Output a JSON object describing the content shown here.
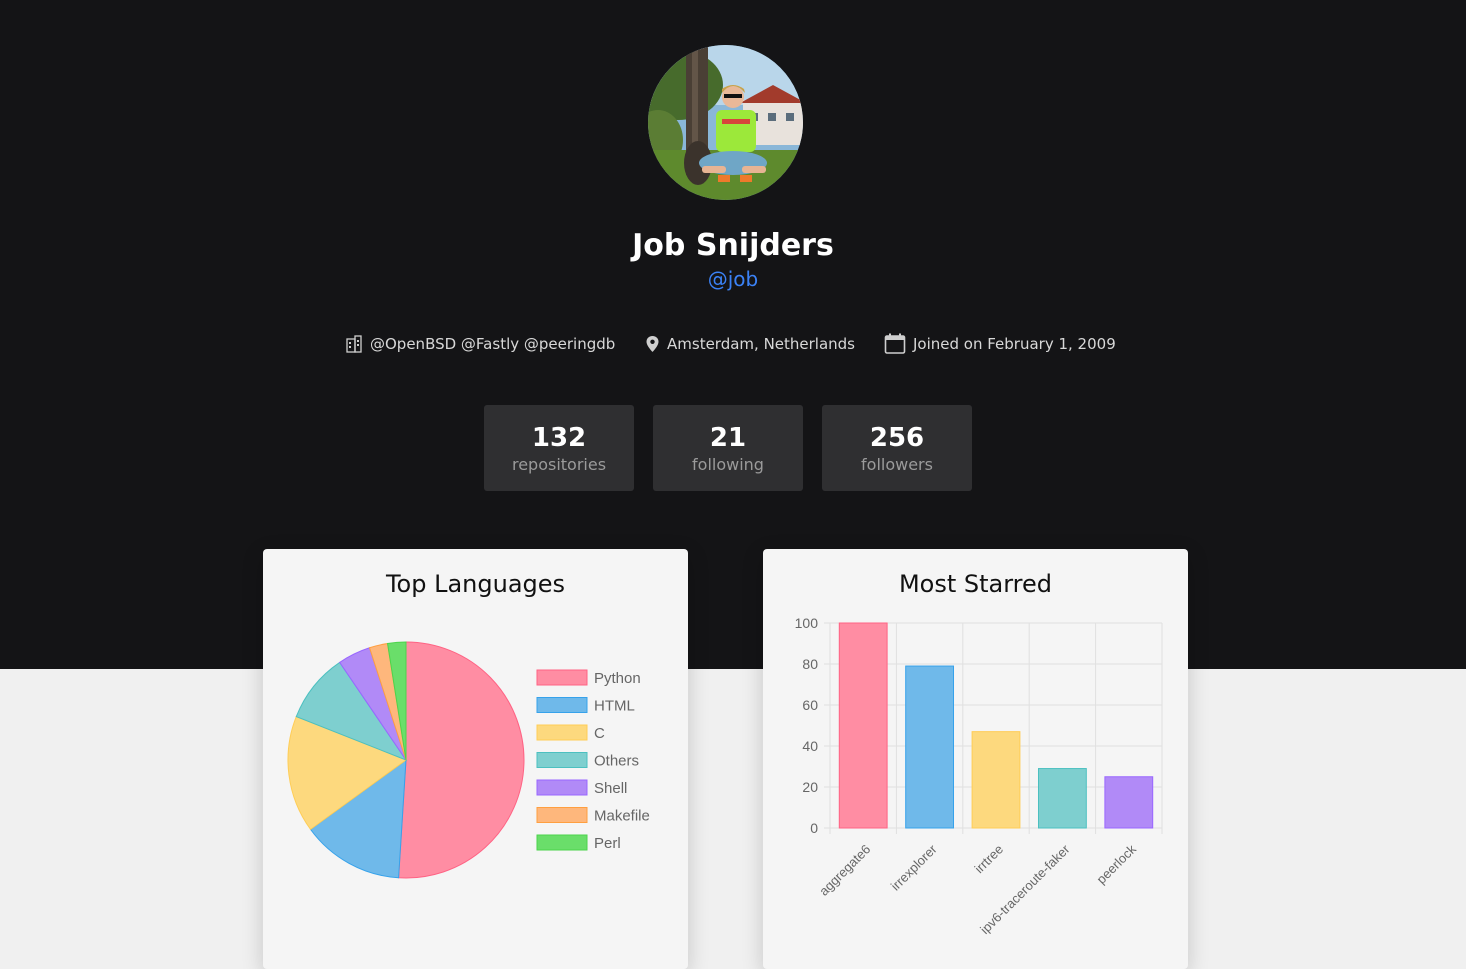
{
  "profile": {
    "name": "Job Snijders",
    "handle": "@job",
    "organizations": "@OpenBSD @Fastly @peeringdb",
    "location": "Amsterdam, Netherlands",
    "joined": "Joined on February 1, 2009"
  },
  "stats": [
    {
      "value": "132",
      "label": "repositories"
    },
    {
      "value": "21",
      "label": "following"
    },
    {
      "value": "256",
      "label": "followers"
    }
  ],
  "icons": {
    "organization": "building-icon",
    "location": "map-pin-icon",
    "joined": "calendar-icon"
  },
  "charts": {
    "languages_title": "Top Languages",
    "starred_title": "Most Starred"
  },
  "chart_data": [
    {
      "type": "pie",
      "title": "Top Languages",
      "legend_position": "right",
      "categories": [
        "Python",
        "HTML",
        "C",
        "Others",
        "Shell",
        "Makefile",
        "Perl"
      ],
      "values": [
        51,
        14,
        16,
        9.5,
        4.5,
        2.5,
        2.5
      ],
      "colors": [
        "#ff8da3",
        "#6fb9ea",
        "#fdd97e",
        "#7ecfcf",
        "#b18af7",
        "#feb77c",
        "#6ade6a"
      ],
      "stroke_colors": [
        "#ff6384",
        "#36a2eb",
        "#ffcd56",
        "#4bc0c0",
        "#9966ff",
        "#ff9f40",
        "#4cd44c"
      ]
    },
    {
      "type": "bar",
      "title": "Most Starred",
      "categories": [
        "aggregate6",
        "irrexplorer",
        "irrtree",
        "ipv6-traceroute-faker",
        "peerlock"
      ],
      "values": [
        100,
        79,
        47,
        29,
        25
      ],
      "ylim": [
        0,
        100
      ],
      "yticks": [
        0,
        20,
        40,
        60,
        80,
        100
      ],
      "grid": true,
      "colors": [
        "#ff8da3",
        "#6fb9ea",
        "#fdd97e",
        "#7ecfcf",
        "#b18af7"
      ],
      "stroke_colors": [
        "#ff6384",
        "#36a2eb",
        "#ffcd56",
        "#4bc0c0",
        "#9966ff"
      ]
    }
  ]
}
